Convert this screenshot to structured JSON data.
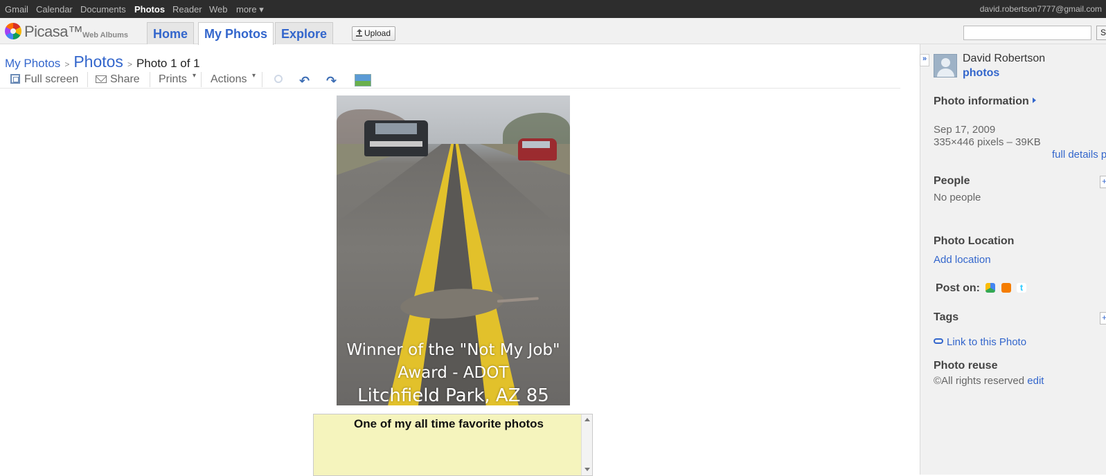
{
  "gbar": {
    "links": [
      "Gmail",
      "Calendar",
      "Documents",
      "Photos",
      "Reader",
      "Web",
      "more ▾"
    ],
    "active": "Photos",
    "account": "david.robertson7777@gmail.com"
  },
  "header": {
    "logo_text": "Picasa™",
    "logo_sub": "Web Albums",
    "tabs": [
      "Home",
      "My Photos",
      "Explore"
    ],
    "selected_tab": "My Photos",
    "upload_label": "Upload",
    "search_button": "S",
    "search_value": ""
  },
  "breadcrumb": {
    "root": "My Photos",
    "album": "Photos",
    "current": "Photo 1 of 1",
    "separator": ">"
  },
  "toolbar": {
    "fullscreen": "Full screen",
    "share": "Share",
    "prints": "Prints",
    "actions": "Actions"
  },
  "photo": {
    "caption_lines": [
      "Winner of the \"Not My Job\"",
      "Award  -  ADOT",
      "Litchfield Park, AZ 85"
    ]
  },
  "description": "One of my all time favorite photos",
  "sidebar": {
    "owner_name": "David Robertson",
    "owner_link": "photos",
    "photo_info_heading": "Photo information",
    "date": "Sep 17, 2009",
    "dimensions": "335×446 pixels – 39KB",
    "full_details": "full details p",
    "people_heading": "People",
    "people_text": "No people",
    "location_heading": "Photo Location",
    "add_location": "Add location",
    "post_on": "Post on:",
    "tags_heading": "Tags",
    "link_to_photo": "Link to this Photo",
    "reuse_heading": "Photo reuse",
    "reuse_text": "©All rights reserved",
    "reuse_edit": "edit",
    "plus": "+"
  },
  "colors": {
    "link": "#3366cc",
    "topbar": "#2d2d2d",
    "description_bg": "#f5f4bd",
    "road_line": "#e2c12b"
  }
}
